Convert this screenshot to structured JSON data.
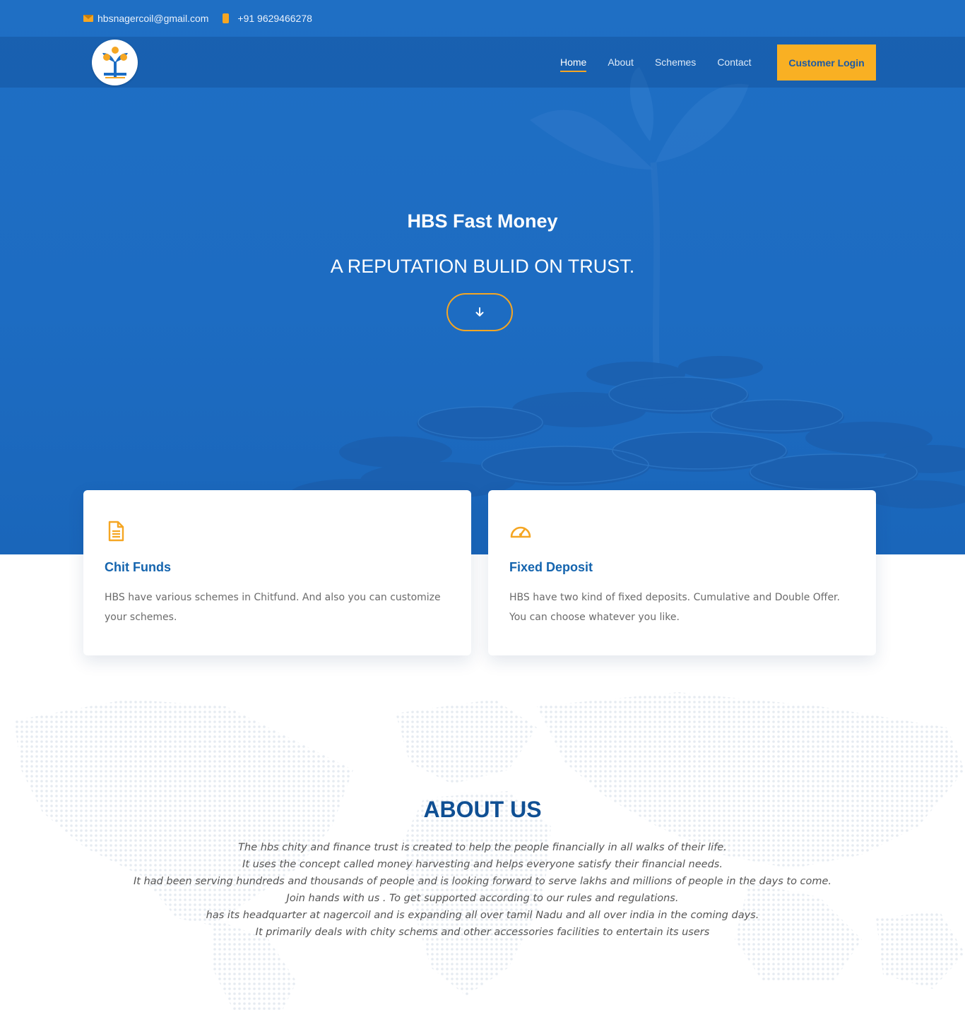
{
  "topbar": {
    "email": "hbsnagercoil@gmail.com",
    "phone": "+91 9629466278"
  },
  "navbar": {
    "logo_icon": "hbs-logo-icon",
    "links": [
      {
        "label": "Home",
        "active": true
      },
      {
        "label": "About",
        "active": false
      },
      {
        "label": "Schemes",
        "active": false
      },
      {
        "label": "Contact",
        "active": false
      }
    ],
    "login_label": "Customer Login"
  },
  "hero": {
    "title": "HBS Fast Money",
    "tagline": "A REPUTATION BULID ON TRUST.",
    "scroll_icon": "arrow-down-icon"
  },
  "cards": [
    {
      "icon": "document-icon",
      "title": "Chit Funds",
      "text": "HBS have various schemes in Chitfund. And also you can customize your schemes."
    },
    {
      "icon": "speedometer-icon",
      "title": "Fixed Deposit",
      "text": "HBS have two kind of fixed deposits. Cumulative and Double Offer. You can choose whatever you like."
    }
  ],
  "about": {
    "title": "ABOUT US",
    "lines": [
      "The hbs chity and finance trust is created to help the people financially in all walks of their life.",
      "It uses the concept called money harvesting and helps everyone satisfy their financial needs.",
      "It had been serving hundreds and thousands of people and is looking forward to serve lakhs and millions of people in the days to come.",
      "Join hands with us . To get supported according to our rules and regulations.",
      "has its headquarter at nagercoil and is expanding all over tamil Nadu and all over india in the coming days.",
      "It primarily deals with chity schems and other accessories facilities to entertain its users"
    ]
  },
  "colors": {
    "primary_blue": "#1d6cc2",
    "accent_yellow": "#f9b023",
    "heading_blue": "#0f4f93"
  }
}
